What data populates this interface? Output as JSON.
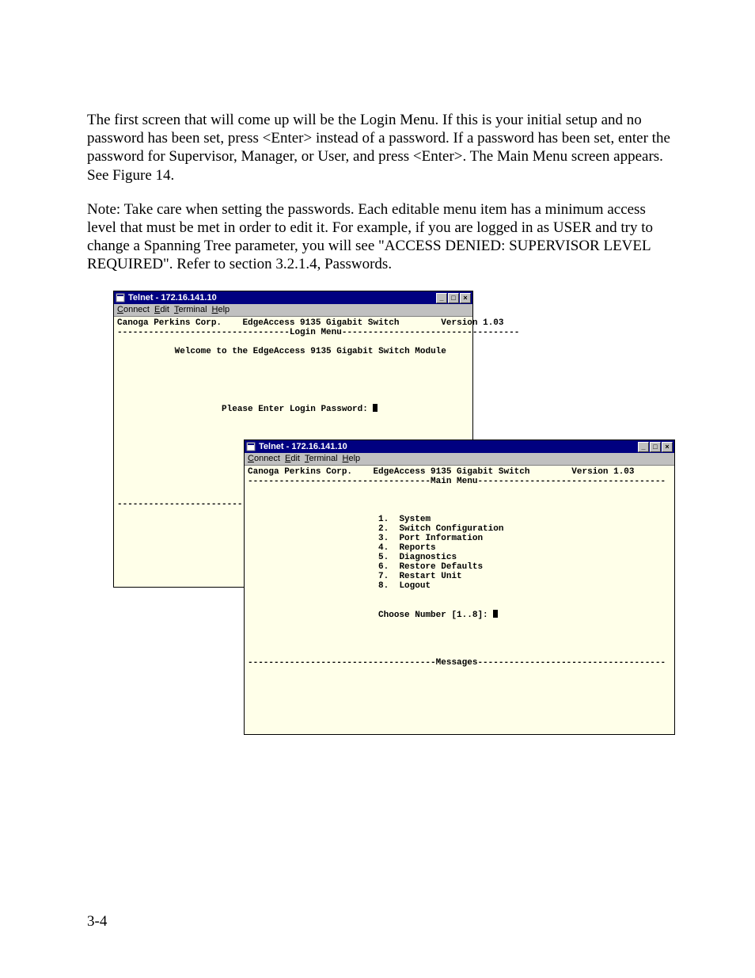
{
  "paragraphs": {
    "p1": "The first screen that will come up will be the Login Menu. If this is your initial setup and no password has been set, press <Enter> instead of a password. If a password has been set, enter the password for Supervisor, Manager, or User, and press <Enter>. The Main Menu screen appears. See Figure 14.",
    "p2": "Note: Take care when setting the passwords. Each editable menu item has a minimum access level that must be met in order to edit it. For example, if you are logged in as USER and try to change a Spanning Tree parameter, you will see \"ACCESS DENIED: SUPERVISOR LEVEL REQUIRED\". Refer to section 3.2.1.4, Passwords."
  },
  "window1": {
    "title": "Telnet - 172.16.141.10",
    "menu": {
      "connect": "Connect",
      "edit": "Edit",
      "terminal": "Terminal",
      "help": "Help"
    },
    "company": "Canoga Perkins Corp.",
    "product": "EdgeAccess 9135 Gigabit Switch",
    "version": "Version 1.03",
    "banner": "Login Menu",
    "welcome": "Welcome to the EdgeAccess 9135 Gigabit Switch Module",
    "prompt": "Please Enter Login Password:"
  },
  "window2": {
    "title": "Telnet - 172.16.141.10",
    "menu": {
      "connect": "Connect",
      "edit": "Edit",
      "terminal": "Terminal",
      "help": "Help"
    },
    "company": "Canoga Perkins Corp.",
    "product": "EdgeAccess 9135 Gigabit Switch",
    "version": "Version 1.03",
    "banner": "Main Menu",
    "items": {
      "i1": "System",
      "i2": "Switch Configuration",
      "i3": "Port Information",
      "i4": "Reports",
      "i5": "Diagnostics",
      "i6": "Restore Defaults",
      "i7": "Restart Unit",
      "i8": "Logout"
    },
    "choose": "Choose Number [1..8]:",
    "messages": "Messages"
  },
  "winbuttons": {
    "min": "_",
    "max": "□",
    "close": "×"
  },
  "page_number": "3-4"
}
